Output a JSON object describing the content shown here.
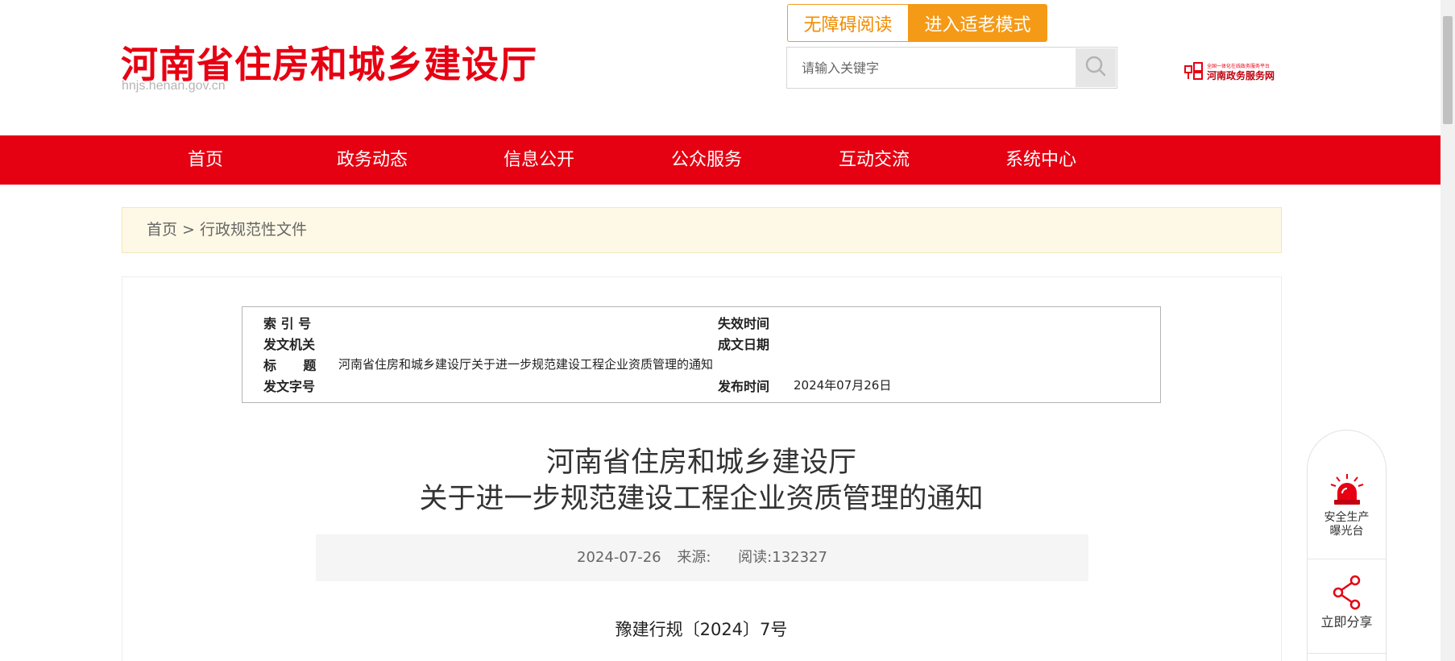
{
  "header": {
    "site_title": "河南省住房和城乡建设厅",
    "site_domain": "hnjs.henan.gov.cn",
    "btn_accessible": "无障碍阅读",
    "btn_elder": "进入适老模式",
    "search_placeholder": "请输入关键字",
    "gov_service_small": "全国一体化在线政务服务平台",
    "gov_service_name": "河南政务服务网"
  },
  "nav": {
    "items": [
      "首页",
      "政务动态",
      "信息公开",
      "公众服务",
      "互动交流",
      "系统中心"
    ]
  },
  "breadcrumb": {
    "home": "首页",
    "separator": " > ",
    "current": "行政规范性文件"
  },
  "info": {
    "index_label": "索 引 号",
    "index_value": "",
    "expire_label": "失效时间",
    "expire_value": "",
    "issuer_label": "发文机关",
    "issuer_value": "",
    "created_label": "成文日期",
    "created_value": "",
    "title_label": "标      题",
    "title_value": "河南省住房和城乡建设厅关于进一步规范建设工程企业资质管理的通知",
    "docno_label": "发文字号",
    "docno_value": "",
    "publish_label": "发布时间",
    "publish_value": "2024年07月26日"
  },
  "article": {
    "title_line1": "河南省住房和城乡建设厅",
    "title_line2": "关于进一步规范建设工程企业资质管理的通知",
    "date": "2024-07-26",
    "source_label": "来源:",
    "source_value": "",
    "reads_label": "阅读:",
    "reads_value": "132327",
    "doc_number": "豫建行规〔2024〕7号"
  },
  "float_panel": {
    "safety_line1": "安全生产",
    "safety_line2": "曝光台",
    "share": "立即分享"
  },
  "colors": {
    "brand_red": "#e50012",
    "accent_orange": "#f59a16"
  }
}
